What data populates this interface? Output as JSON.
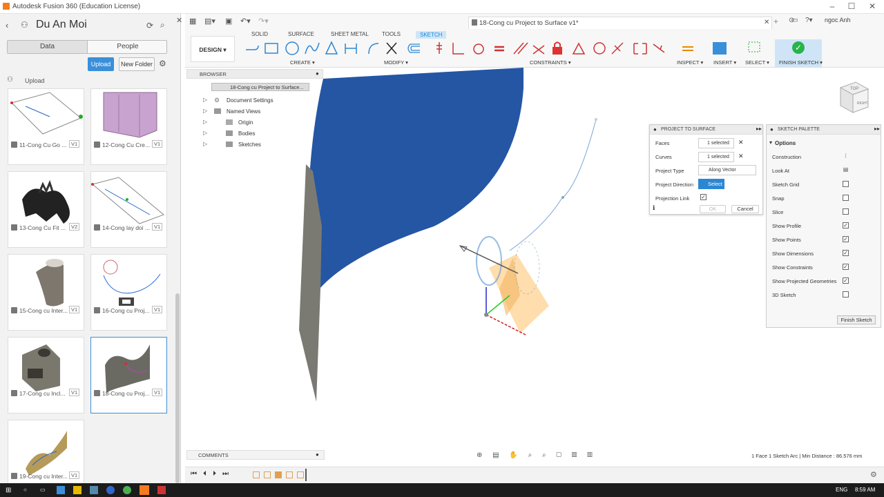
{
  "window": {
    "title": "Autodesk Fusion 360 (Education License)",
    "brand_color": "#f47b20"
  },
  "left_panel": {
    "project_name": "Du An Moi",
    "tabs": [
      "Data",
      "People"
    ],
    "upload_label": "Upload",
    "new_folder_label": "New Folder",
    "breadcrumb": "Upload",
    "items": [
      {
        "label": "11-Cong Cu Go ...",
        "version": "V1"
      },
      {
        "label": "12-Cong Cu Cre...",
        "version": "V1"
      },
      {
        "label": "13-Cong Cu Fit ...",
        "version": "V2"
      },
      {
        "label": "14-Cong lay doi ...",
        "version": "V1"
      },
      {
        "label": "15-Cong cu Inter...",
        "version": "V1"
      },
      {
        "label": "16-Cong cu Proj...",
        "version": "V1"
      },
      {
        "label": "17-Cong cu Incl...",
        "version": "V1"
      },
      {
        "label": "18-Cong cu Proj...",
        "version": "V1"
      },
      {
        "label": "19-Cong cu Inter...",
        "version": "V1"
      }
    ]
  },
  "document": {
    "tab_title": "18-Cong cu Project to Surface v1*",
    "user": "ngoc Anh"
  },
  "toolbar": {
    "workspace": "DESIGN ▾",
    "tabs": [
      "SOLID",
      "SURFACE",
      "SHEET METAL",
      "TOOLS",
      "SKETCH"
    ],
    "active_tab": "SKETCH",
    "groups": [
      "CREATE ▾",
      "MODIFY ▾",
      "CONSTRAINTS ▾",
      "INSPECT ▾",
      "INSERT ▾",
      "SELECT ▾",
      "FINISH SKETCH ▾"
    ]
  },
  "browser": {
    "title": "BROWSER",
    "root": "18-Cong cu Project to Surface...",
    "nodes": [
      "Document Settings",
      "Named Views",
      "Origin",
      "Bodies",
      "Sketches"
    ]
  },
  "dialog": {
    "title": "PROJECT TO SURFACE",
    "faces_label": "Faces",
    "faces_value": "1 selected",
    "curves_label": "Curves",
    "curves_value": "1 selected",
    "project_type_label": "Project Type",
    "project_type_value": "Along Vector",
    "direction_label": "Project Direction",
    "direction_value": "Select",
    "link_label": "Projection Link",
    "ok": "OK",
    "cancel": "Cancel"
  },
  "palette": {
    "title": "SKETCH PALETTE",
    "section": "Options",
    "rows": [
      {
        "label": "Construction",
        "checked": null
      },
      {
        "label": "Look At",
        "checked": null
      },
      {
        "label": "Sketch Grid",
        "checked": false
      },
      {
        "label": "Snap",
        "checked": false
      },
      {
        "label": "Slice",
        "checked": false
      },
      {
        "label": "Show Profile",
        "checked": true
      },
      {
        "label": "Show Points",
        "checked": true
      },
      {
        "label": "Show Dimensions",
        "checked": true
      },
      {
        "label": "Show Constraints",
        "checked": true
      },
      {
        "label": "Show Projected Geometries",
        "checked": true
      },
      {
        "label": "3D Sketch",
        "checked": false
      }
    ],
    "finish_label": "Finish Sketch"
  },
  "comments_label": "COMMENTS",
  "status_text": "1 Face 1 Sketch Arc | Min Distance : 86.576 mm",
  "taskbar": {
    "lang": "ENG",
    "time": "8:59 AM"
  },
  "colors": {
    "surface": "#2456a4",
    "accent": "#2c87d3",
    "finish": "#28b44a"
  }
}
